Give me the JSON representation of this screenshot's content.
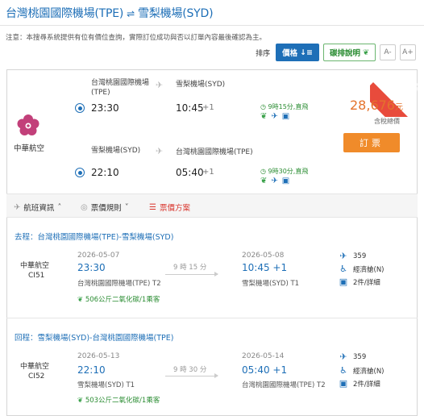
{
  "header": {
    "from": "台灣桃園國際機場(TPE)",
    "arrows": "⇌",
    "to": "雪梨機場(SYD)"
  },
  "notice": "注意：本搜尋系統提供有位有價位查詢，實際訂位成功與否以訂單內容最後確認為主。",
  "sort": {
    "label": "排序",
    "price_btn": "價格",
    "green_btn": "碳排說明",
    "font_minus": "A-",
    "font_plus": "A+"
  },
  "ribbon": "最佳推薦",
  "airline": {
    "name": "中華航空",
    "logo": "plum-blossom-logo"
  },
  "outbound": {
    "from": "台灣桃園國際機場(TPE)",
    "to": "雪梨機場(SYD)",
    "dep_time": "23:30",
    "arr_time": "10:45",
    "plus": "+1",
    "duration": "9時15分,直飛"
  },
  "inbound": {
    "from": "雪梨機場(SYD)",
    "to": "台灣桃園國際機場(TPE)",
    "dep_time": "22:10",
    "arr_time": "05:40",
    "plus": "+1",
    "duration": "9時30分,直飛"
  },
  "price": {
    "value": "28,676",
    "unit": "元",
    "note": "含稅總價",
    "book": "訂票"
  },
  "tabs": {
    "info": "航班資訊",
    "rules": "票價規則",
    "plan": "票價方案"
  },
  "legs": [
    {
      "head": "去程：台灣桃園國際機場(TPE)-雪梨機場(SYD)",
      "airline": "中華航空",
      "flight_no": "CI51",
      "dep_date": "2026-05-07",
      "dep_time": "23:30",
      "dep_airport": "台灣桃園國際機場(TPE) T2",
      "duration": "9 時 15 分",
      "arr_date": "2026-05-08",
      "arr_time": "10:45 +1",
      "arr_airport": "雪梨機場(SYD) T1",
      "co2": "506公斤二氧化碳/1乘客",
      "aircraft": "359",
      "cabin": "經濟艙(N)",
      "baggage": "2件/詳細"
    },
    {
      "head": "回程：雪梨機場(SYD)-台灣桃園國際機場(TPE)",
      "airline": "中華航空",
      "flight_no": "CI52",
      "dep_date": "2026-05-13",
      "dep_time": "22:10",
      "dep_airport": "雪梨機場(SYD) T1",
      "duration": "9 時 30 分",
      "arr_date": "2026-05-14",
      "arr_time": "05:40 +1",
      "arr_airport": "台灣桃園國際機場(TPE) T2",
      "co2": "503公斤二氧化碳/1乘客",
      "aircraft": "359",
      "cabin": "經濟艙(N)",
      "baggage": "2件/詳細"
    }
  ]
}
